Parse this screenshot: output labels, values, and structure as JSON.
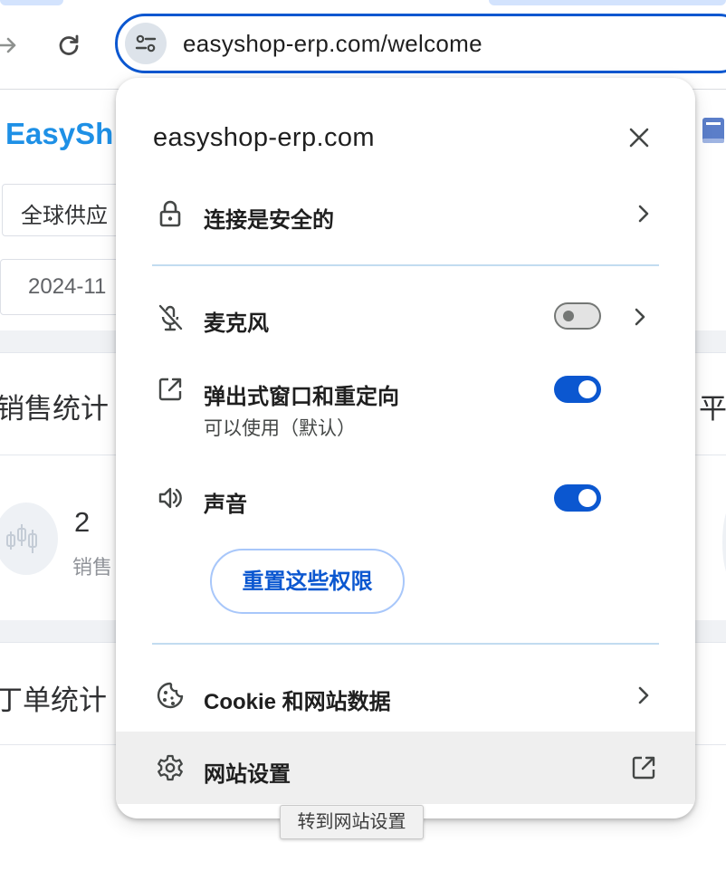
{
  "browser": {
    "url": "easyshop-erp.com/welcome",
    "icons": {
      "forward": "forward-arrow-icon",
      "reload": "reload-icon",
      "site_info": "tune-icon"
    },
    "accent": "#0b57d0"
  },
  "page": {
    "brand": "EasyShop",
    "brand_visible": "EasySh",
    "supplier_select": "全球供应",
    "date_value": "2024-11",
    "sales_title": "销售统计",
    "right_title": "平",
    "stat_value": "2",
    "stat_label": "销售",
    "order_title": "订单统计",
    "order_title_visible": "丁单统计"
  },
  "popup": {
    "title": "easyshop-erp.com",
    "connection": {
      "label": "连接是安全的",
      "icon": "lock-icon"
    },
    "permissions": [
      {
        "label": "麦克风",
        "icon": "mic-off-icon",
        "enabled": false
      },
      {
        "label": "弹出式窗口和重定向",
        "sub": "可以使用（默认）",
        "icon": "open-external-icon",
        "enabled": true
      },
      {
        "label": "声音",
        "icon": "speaker-icon",
        "enabled": true
      }
    ],
    "reset_button": "重置这些权限",
    "cookies": {
      "label": "Cookie 和网站数据",
      "icon": "cookie-icon"
    },
    "site_settings": {
      "label": "网站设置",
      "icon": "gear-icon"
    }
  },
  "tooltip": "转到网站设置"
}
